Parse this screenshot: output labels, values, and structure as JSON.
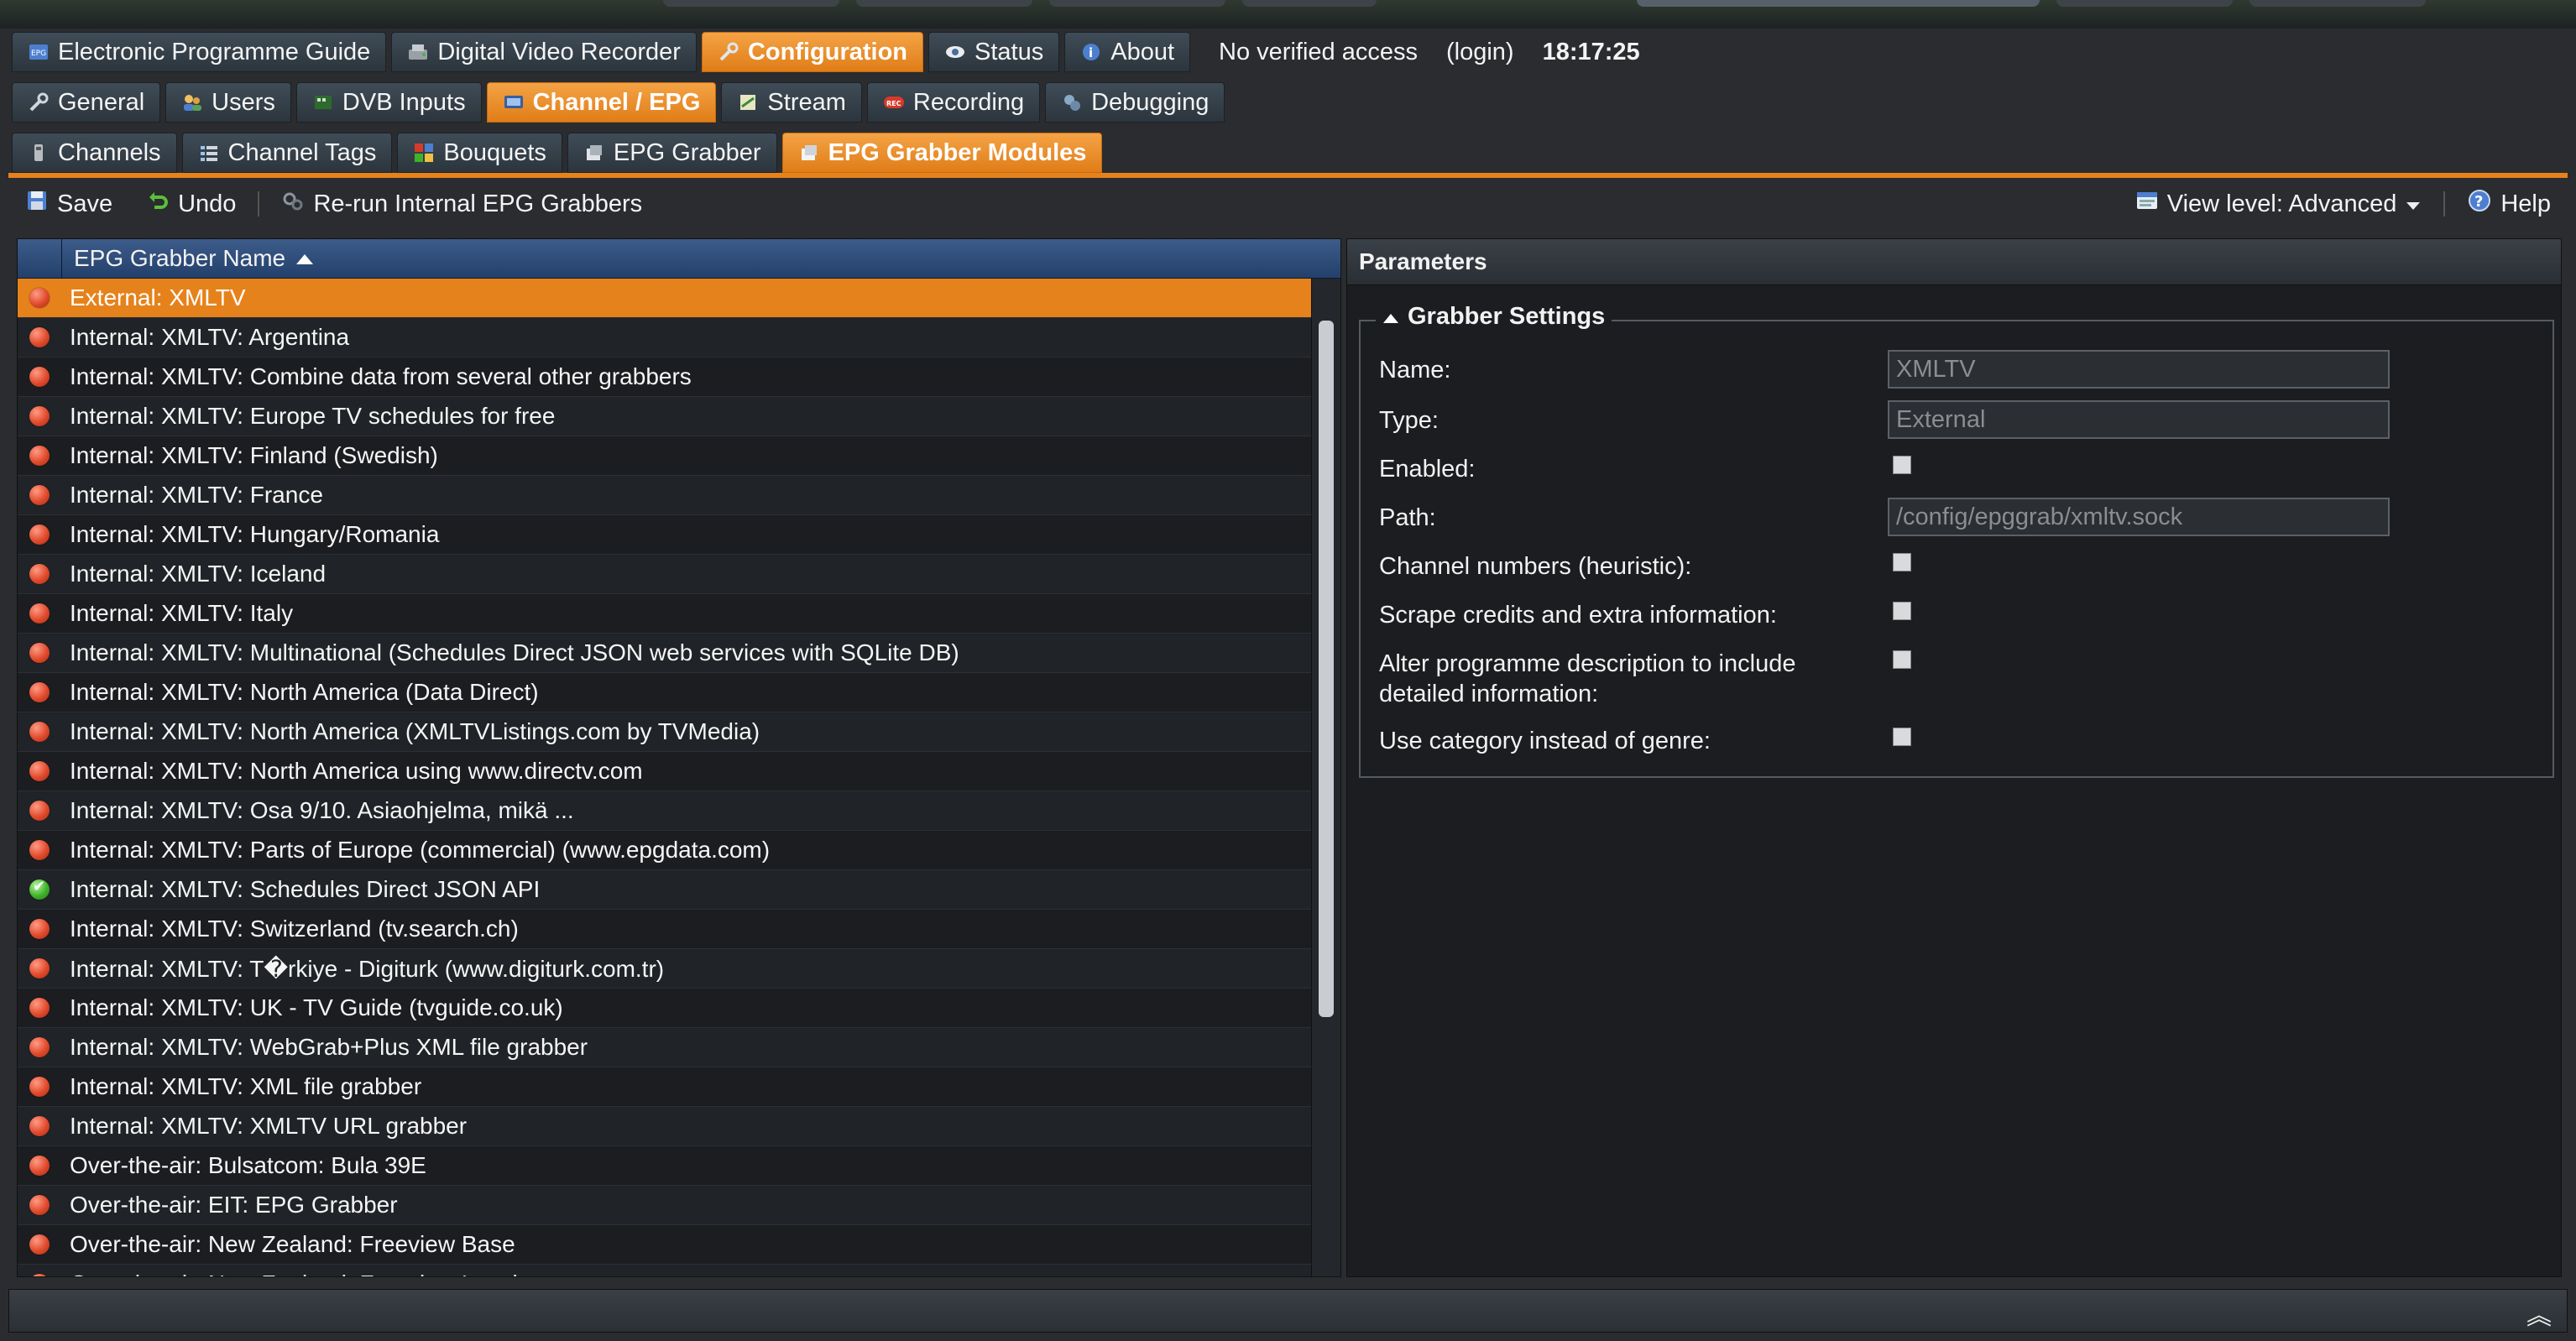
{
  "nav": {
    "main_tabs": [
      {
        "label": "Electronic Programme Guide",
        "icon": "epg-icon"
      },
      {
        "label": "Digital Video Recorder",
        "icon": "dvr-icon"
      },
      {
        "label": "Configuration",
        "icon": "wrench-icon",
        "active": true
      },
      {
        "label": "Status",
        "icon": "eye-icon"
      },
      {
        "label": "About",
        "icon": "info-icon"
      }
    ],
    "access_text": "No verified access",
    "login_text": "(login)",
    "clock": "18:17:25",
    "config_tabs": [
      {
        "label": "General",
        "icon": "wrench-icon"
      },
      {
        "label": "Users",
        "icon": "users-icon"
      },
      {
        "label": "DVB Inputs",
        "icon": "dvb-icon"
      },
      {
        "label": "Channel / EPG",
        "icon": "tv-icon",
        "active": true
      },
      {
        "label": "Stream",
        "icon": "stream-icon"
      },
      {
        "label": "Recording",
        "icon": "record-icon"
      },
      {
        "label": "Debugging",
        "icon": "bug-icon"
      }
    ],
    "channel_tabs": [
      {
        "label": "Channels",
        "icon": "channel-icon"
      },
      {
        "label": "Channel Tags",
        "icon": "tags-icon"
      },
      {
        "label": "Bouquets",
        "icon": "bouquet-icon"
      },
      {
        "label": "EPG Grabber",
        "icon": "grabber-icon"
      },
      {
        "label": "EPG Grabber Modules",
        "icon": "modules-icon",
        "active": true
      }
    ]
  },
  "toolbar": {
    "save": "Save",
    "undo": "Undo",
    "rerun": "Re-run Internal EPG Grabbers",
    "view_level": "View level: Advanced",
    "help": "Help"
  },
  "grid": {
    "column_header": "EPG Grabber Name",
    "rows": [
      {
        "name": "External: XMLTV",
        "status": "disabled",
        "selected": true
      },
      {
        "name": "Internal: XMLTV: Argentina",
        "status": "disabled"
      },
      {
        "name": "Internal: XMLTV: Combine data from several other grabbers",
        "status": "disabled"
      },
      {
        "name": "Internal: XMLTV: Europe TV schedules for free",
        "status": "disabled"
      },
      {
        "name": "Internal: XMLTV: Finland (Swedish)",
        "status": "disabled"
      },
      {
        "name": "Internal: XMLTV: France",
        "status": "disabled"
      },
      {
        "name": "Internal: XMLTV: Hungary/Romania",
        "status": "disabled"
      },
      {
        "name": "Internal: XMLTV: Iceland",
        "status": "disabled"
      },
      {
        "name": "Internal: XMLTV: Italy",
        "status": "disabled"
      },
      {
        "name": "Internal: XMLTV: Multinational (Schedules Direct JSON web services with SQLite DB)",
        "status": "disabled"
      },
      {
        "name": "Internal: XMLTV: North America (Data Direct)",
        "status": "disabled"
      },
      {
        "name": "Internal: XMLTV: North America (XMLTVListings.com by TVMedia)",
        "status": "disabled"
      },
      {
        "name": "Internal: XMLTV: North America using www.directv.com",
        "status": "disabled"
      },
      {
        "name": "Internal: XMLTV: Osa 9/10. Asiaohjelma, mikä ...",
        "status": "disabled"
      },
      {
        "name": "Internal: XMLTV: Parts of Europe (commercial) (www.epgdata.com)",
        "status": "disabled"
      },
      {
        "name": "Internal: XMLTV: Schedules Direct JSON API",
        "status": "enabled"
      },
      {
        "name": "Internal: XMLTV: Switzerland (tv.search.ch)",
        "status": "disabled"
      },
      {
        "name": "Internal: XMLTV: T�rkiye - Digiturk (www.digiturk.com.tr)",
        "status": "disabled"
      },
      {
        "name": "Internal: XMLTV: UK - TV Guide (tvguide.co.uk)",
        "status": "disabled"
      },
      {
        "name": "Internal: XMLTV: WebGrab+Plus XML file grabber",
        "status": "disabled"
      },
      {
        "name": "Internal: XMLTV: XML file grabber",
        "status": "disabled"
      },
      {
        "name": "Internal: XMLTV: XMLTV URL grabber",
        "status": "disabled"
      },
      {
        "name": "Over-the-air: Bulsatcom: Bula 39E",
        "status": "disabled"
      },
      {
        "name": "Over-the-air: EIT: EPG Grabber",
        "status": "disabled"
      },
      {
        "name": "Over-the-air: New Zealand: Freeview Base",
        "status": "disabled"
      },
      {
        "name": "Over-the-air: New Zealand: Freeview Local",
        "status": "disabled"
      }
    ]
  },
  "params": {
    "title": "Parameters",
    "section_title": "Grabber Settings",
    "fields": {
      "name_label": "Name:",
      "name_value": "XMLTV",
      "type_label": "Type:",
      "type_value": "External",
      "enabled_label": "Enabled:",
      "path_label": "Path:",
      "path_value": "/config/epggrab/xmltv.sock",
      "channel_numbers_label": "Channel numbers (heuristic):",
      "scrape_credits_label": "Scrape credits and extra information:",
      "alter_desc_label_1": "Alter programme description to include",
      "alter_desc_label_2": "detailed information:",
      "use_category_label": "Use category instead of genre:"
    }
  },
  "colors": {
    "accent": "#e6821b",
    "disabled_dot": "#e04a2c",
    "enabled_dot": "#3fb22a",
    "header_blue": "#2f4f7c"
  }
}
